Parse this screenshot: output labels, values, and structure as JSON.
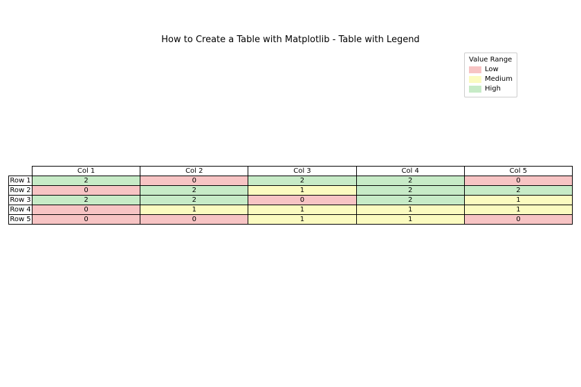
{
  "title": "How to Create a Table with Matplotlib - Table with Legend",
  "legend": {
    "title": "Value Range",
    "items": [
      {
        "label": "Low",
        "color": "#f7c4c4"
      },
      {
        "label": "Medium",
        "color": "#fbfbc0"
      },
      {
        "label": "High",
        "color": "#c7ebc7"
      }
    ]
  },
  "chart_data": {
    "type": "table",
    "title": "How to Create a Table with Matplotlib - Table with Legend",
    "columns": [
      "Col 1",
      "Col 2",
      "Col 3",
      "Col 4",
      "Col 5"
    ],
    "rows": [
      "Row 1",
      "Row 2",
      "Row 3",
      "Row 4",
      "Row 5"
    ],
    "values": [
      [
        2,
        0,
        2,
        2,
        0
      ],
      [
        0,
        2,
        1,
        2,
        2
      ],
      [
        2,
        2,
        0,
        2,
        1
      ],
      [
        0,
        1,
        1,
        1,
        1
      ],
      [
        0,
        0,
        1,
        1,
        0
      ]
    ],
    "color_map": {
      "0": "#f7c4c4",
      "1": "#fbfbc0",
      "2": "#c7ebc7"
    },
    "legend_mapping": {
      "Low": 0,
      "Medium": 1,
      "High": 2
    }
  }
}
